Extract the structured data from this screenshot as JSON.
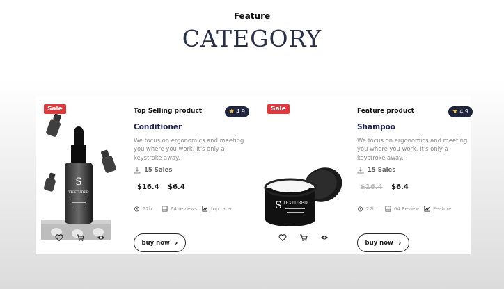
{
  "section": {
    "eyebrow": "Feature",
    "heading": "CATEGORY"
  },
  "colors": {
    "sale_badge": "#e0393d",
    "rating_bg": "#20243c",
    "star": "#f5c332",
    "product_title": "#1d2150"
  },
  "products": [
    {
      "badge": "Sale",
      "image_icon": "serum-dropper-bottles",
      "tag": "Top Selling product",
      "rating": "4.9",
      "name": "Conditioner",
      "description": "We focus on ergonomics and meeting you where you work. It's only a keystroke away.",
      "sales": "15 Sales",
      "price_old": "$16.4",
      "price_new": "$6.4",
      "meta": [
        "22h...",
        "64 reviews",
        "top rated"
      ],
      "buy_label": "buy now",
      "brand_text": "TEXTURED"
    },
    {
      "badge": "Sale",
      "image_icon": "cream-jar",
      "tag": "Feature product",
      "rating": "4.9",
      "name": "Shampoo",
      "description": "We focus on ergonomics and meeting you where you work. It's only a keystroke away.",
      "sales": "15 Sales",
      "price_old": "$16.4",
      "price_new": "$6.4",
      "meta": [
        "22h...",
        "64 Review",
        "Feature"
      ],
      "buy_label": "buy now",
      "brand_text": "TEXTURED"
    }
  ]
}
